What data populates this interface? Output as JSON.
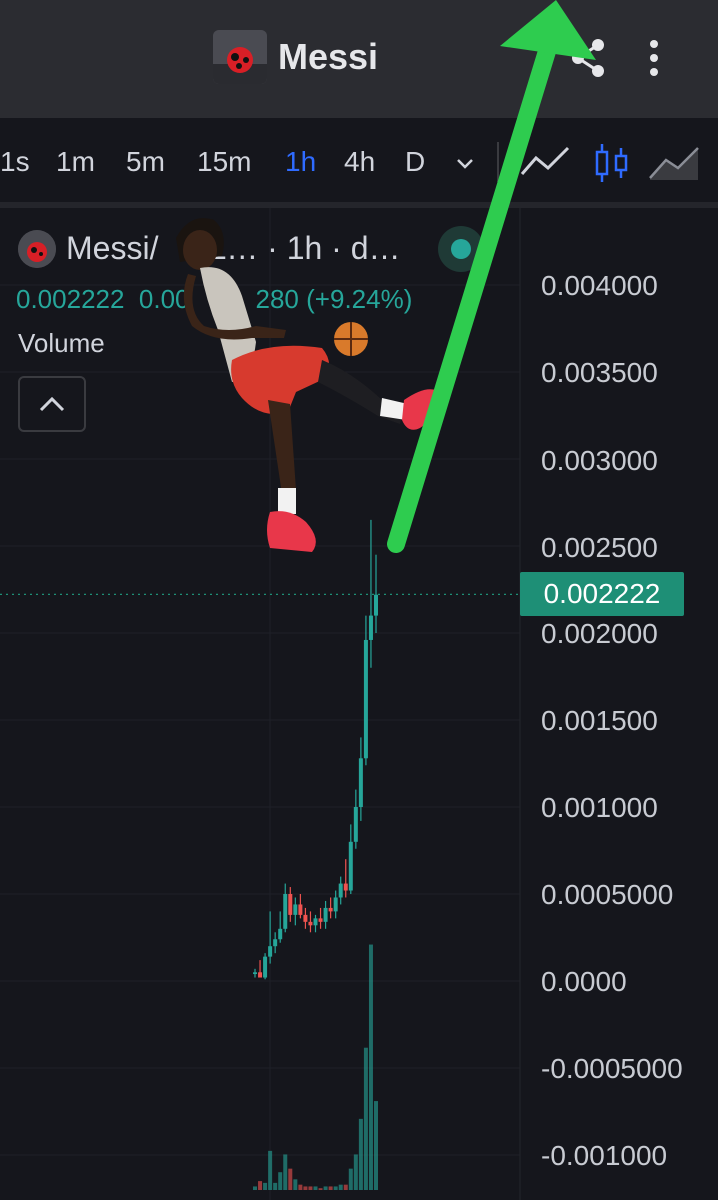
{
  "app": {
    "title": "Messi"
  },
  "intervals": [
    {
      "label": "1s",
      "active": false
    },
    {
      "label": "1m",
      "active": false
    },
    {
      "label": "5m",
      "active": false
    },
    {
      "label": "15m",
      "active": false
    },
    {
      "label": "1h",
      "active": true
    },
    {
      "label": "4h",
      "active": false
    },
    {
      "label": "D",
      "active": false
    }
  ],
  "toolbar_icons": [
    "interval-dropdown-icon",
    "line-chart-icon",
    "candlestick-icon",
    "area-chart-icon"
  ],
  "legend": {
    "symbol": "Messi/",
    "symbol_tail": "L… · 1h · d…",
    "price": "0.002222",
    "change_fragment": "0.00",
    "change_abs_tail": "280",
    "change_pct": "(+9.24%)",
    "volume_label": "Volume"
  },
  "price_axis": {
    "labels": [
      "0.004000",
      "0.003500",
      "0.003000",
      "0.002500",
      "0.002000",
      "0.001500",
      "0.001000",
      "0.0005000",
      "0.0000",
      "-0.0005000",
      "-0.001000"
    ],
    "current_price": "0.002222"
  },
  "colors": {
    "up": "#26a69a",
    "down": "#ef5350",
    "accent": "#2f6bff",
    "arrow": "#2ecc4f"
  },
  "chart_data": {
    "type": "candlestick",
    "ylim": [
      -0.0011,
      0.0042
    ],
    "last_price": 0.002222,
    "candles": [
      {
        "o": 4e-05,
        "h": 7e-05,
        "l": 2e-05,
        "c": 5e-05,
        "v": 2e-05
      },
      {
        "o": 5e-05,
        "h": 0.00012,
        "l": 3e-05,
        "c": 2e-05,
        "v": 5e-05
      },
      {
        "o": 2e-05,
        "h": 0.00016,
        "l": 1e-05,
        "c": 0.00014,
        "v": 4e-05
      },
      {
        "o": 0.00014,
        "h": 0.0004,
        "l": 0.0001,
        "c": 0.0002,
        "v": 0.00022
      },
      {
        "o": 0.0002,
        "h": 0.00028,
        "l": 0.00016,
        "c": 0.00024,
        "v": 4e-05
      },
      {
        "o": 0.00024,
        "h": 0.0004,
        "l": 0.00022,
        "c": 0.0003,
        "v": 0.0001
      },
      {
        "o": 0.0003,
        "h": 0.00056,
        "l": 0.00028,
        "c": 0.0005,
        "v": 0.0002
      },
      {
        "o": 0.0005,
        "h": 0.00054,
        "l": 0.00034,
        "c": 0.00038,
        "v": 0.00012
      },
      {
        "o": 0.00038,
        "h": 0.00048,
        "l": 0.00032,
        "c": 0.00044,
        "v": 6e-05
      },
      {
        "o": 0.00044,
        "h": 0.0005,
        "l": 0.00036,
        "c": 0.00038,
        "v": 3e-05
      },
      {
        "o": 0.00038,
        "h": 0.00042,
        "l": 0.0003,
        "c": 0.00034,
        "v": 2e-05
      },
      {
        "o": 0.00034,
        "h": 0.0004,
        "l": 0.00028,
        "c": 0.00032,
        "v": 2e-05
      },
      {
        "o": 0.00032,
        "h": 0.00038,
        "l": 0.00028,
        "c": 0.00036,
        "v": 2e-05
      },
      {
        "o": 0.00036,
        "h": 0.00042,
        "l": 0.0003,
        "c": 0.00034,
        "v": 1e-05
      },
      {
        "o": 0.00034,
        "h": 0.00046,
        "l": 0.0003,
        "c": 0.00042,
        "v": 2e-05
      },
      {
        "o": 0.00042,
        "h": 0.00048,
        "l": 0.00036,
        "c": 0.0004,
        "v": 2e-05
      },
      {
        "o": 0.0004,
        "h": 0.00052,
        "l": 0.00036,
        "c": 0.00048,
        "v": 2e-05
      },
      {
        "o": 0.00048,
        "h": 0.0006,
        "l": 0.00044,
        "c": 0.00056,
        "v": 3e-05
      },
      {
        "o": 0.00056,
        "h": 0.0007,
        "l": 0.00048,
        "c": 0.00052,
        "v": 3e-05
      },
      {
        "o": 0.00052,
        "h": 0.0009,
        "l": 0.0005,
        "c": 0.0008,
        "v": 0.00012
      },
      {
        "o": 0.0008,
        "h": 0.0011,
        "l": 0.00076,
        "c": 0.001,
        "v": 0.0002
      },
      {
        "o": 0.001,
        "h": 0.0014,
        "l": 0.00092,
        "c": 0.00128,
        "v": 0.0004
      },
      {
        "o": 0.00128,
        "h": 0.0021,
        "l": 0.00124,
        "c": 0.00196,
        "v": 0.0008
      },
      {
        "o": 0.00196,
        "h": 0.00265,
        "l": 0.0018,
        "c": 0.0021,
        "v": 0.00138
      },
      {
        "o": 0.0021,
        "h": 0.00245,
        "l": 0.002,
        "c": 0.00222,
        "v": 0.0005
      }
    ]
  }
}
